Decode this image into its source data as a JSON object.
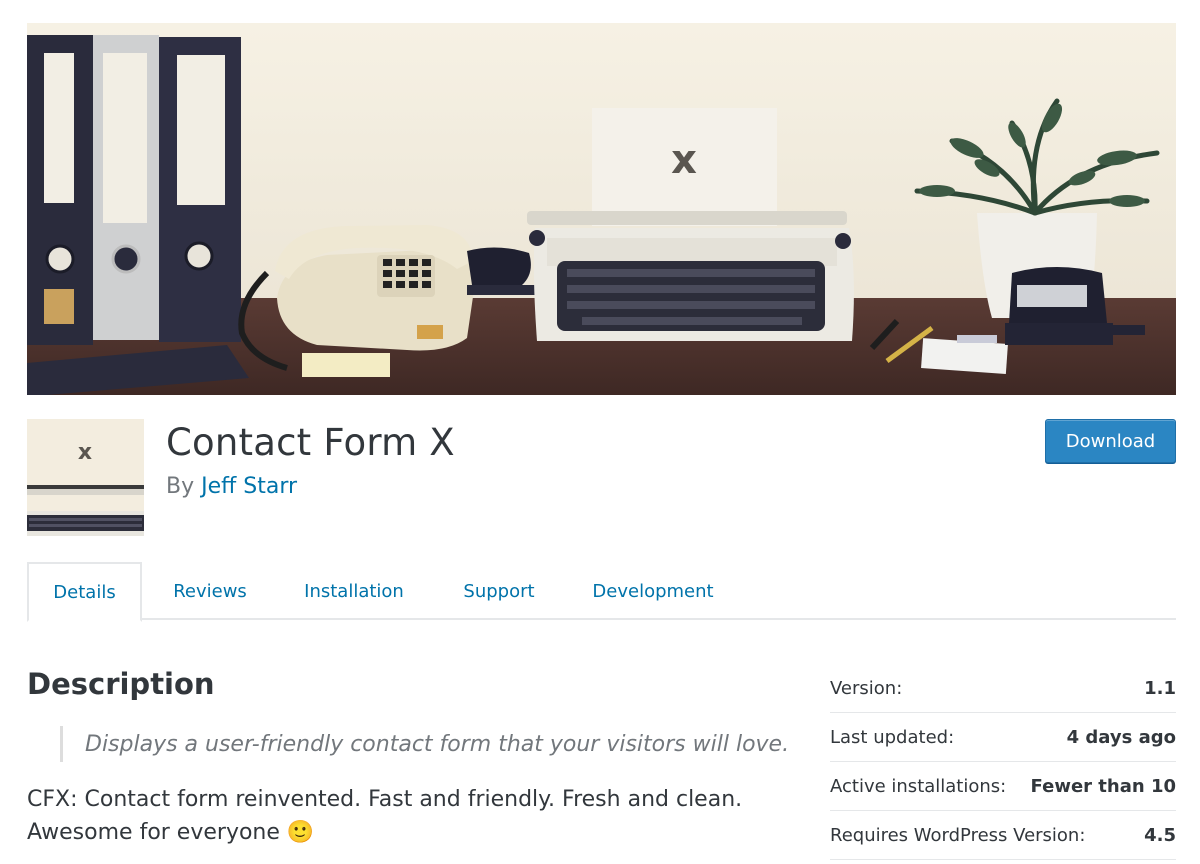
{
  "plugin": {
    "name": "Contact Form X",
    "by_prefix": "By",
    "author": "Jeff Starr",
    "banner_letter": "x",
    "icon_letter": "x",
    "download_label": "Download"
  },
  "tabs": [
    {
      "label": "Details",
      "active": true
    },
    {
      "label": "Reviews",
      "active": false
    },
    {
      "label": "Installation",
      "active": false
    },
    {
      "label": "Support",
      "active": false
    },
    {
      "label": "Development",
      "active": false
    }
  ],
  "description": {
    "heading": "Description",
    "quote": "Displays a user-friendly contact form that your visitors will love.",
    "body": "CFX: Contact form reinvented. Fast and friendly. Fresh and clean. Awesome for everyone",
    "emoji": "🙂"
  },
  "meta": [
    {
      "label": "Version:",
      "value": "1.1"
    },
    {
      "label": "Last updated:",
      "value": "4 days ago"
    },
    {
      "label": "Active installations:",
      "value": "Fewer than 10"
    },
    {
      "label": "Requires WordPress Version:",
      "value": "4.5"
    }
  ],
  "colors": {
    "link": "#0073aa",
    "button": "#2b86c3",
    "text": "#32373c",
    "muted": "#72777c"
  }
}
